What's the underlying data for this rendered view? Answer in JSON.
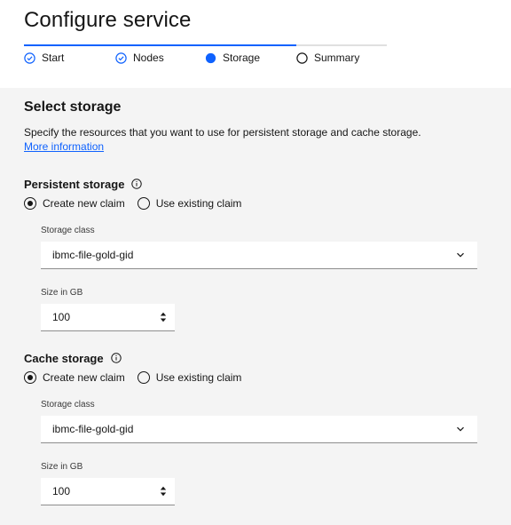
{
  "page": {
    "title": "Configure service"
  },
  "progress": {
    "steps": [
      {
        "label": "Start",
        "state": "complete",
        "icon": "checkmark-outline-icon"
      },
      {
        "label": "Nodes",
        "state": "complete",
        "icon": "checkmark-outline-icon"
      },
      {
        "label": "Storage",
        "state": "current",
        "icon": "current-step-icon"
      },
      {
        "label": "Summary",
        "state": "incomplete",
        "icon": "incomplete-step-icon"
      }
    ],
    "accent": "#0f62fe"
  },
  "main": {
    "title": "Select storage",
    "description": "Specify the resources that you want to use for persistent storage and cache storage.",
    "more_link": "More information"
  },
  "persistent": {
    "title": "Persistent storage",
    "radio_new": "Create new claim",
    "radio_existing": "Use existing claim",
    "selected": "Create new claim",
    "storage_class_label": "Storage class",
    "storage_class_value": "ibmc-file-gold-gid",
    "size_label": "Size in GB",
    "size_value": "100"
  },
  "cache": {
    "title": "Cache storage",
    "radio_new": "Create new claim",
    "radio_existing": "Use existing claim",
    "selected": "Create new claim",
    "storage_class_label": "Storage class",
    "storage_class_value": "ibmc-file-gold-gid",
    "size_label": "Size in GB",
    "size_value": "100"
  }
}
